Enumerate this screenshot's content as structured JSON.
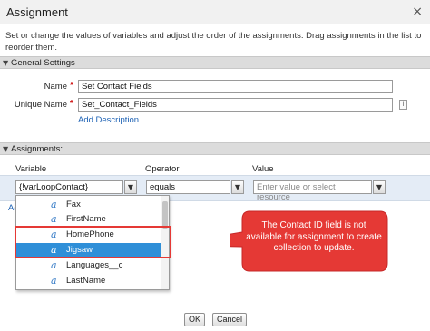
{
  "dialog": {
    "title": "Assignment",
    "close_glyph": "×",
    "description": "Set or change the values of variables and adjust the order of the assignments. Drag assignments in the list to reorder them."
  },
  "general_settings": {
    "heading": "General Settings",
    "name_label": "Name",
    "name_value": "Set Contact Fields",
    "unique_name_label": "Unique Name",
    "unique_name_value": "Set_Contact_Fields",
    "info_icon": "i",
    "add_description": "Add Description"
  },
  "assignments": {
    "heading": "Assignments:",
    "col_variable": "Variable",
    "col_operator": "Operator",
    "col_value": "Value",
    "variable_value": "{!varLoopContact}",
    "operator_value": "equals",
    "value_placeholder": "Enter value or select resource",
    "truncated_link": "Add"
  },
  "dropdown": {
    "items": [
      {
        "label": "Fax",
        "icon": "field-a-icon"
      },
      {
        "label": "FirstName",
        "icon": "field-a-icon"
      },
      {
        "label": "HomePhone",
        "icon": "field-a-icon"
      },
      {
        "label": "Jigsaw",
        "icon": "field-a-icon",
        "selected": true
      },
      {
        "label": "Languages__c",
        "icon": "field-a-icon"
      },
      {
        "label": "LastName",
        "icon": "field-a-icon"
      }
    ]
  },
  "callout": {
    "text": "The Contact ID field is not available for assignment to create collection to update.",
    "color": "#e53935"
  },
  "footer": {
    "ok_label": "OK",
    "cancel_label": "Cancel"
  },
  "colors": {
    "link": "#1f63b5",
    "selected_row": "#2f8fd8",
    "highlight_border": "#e53935"
  }
}
